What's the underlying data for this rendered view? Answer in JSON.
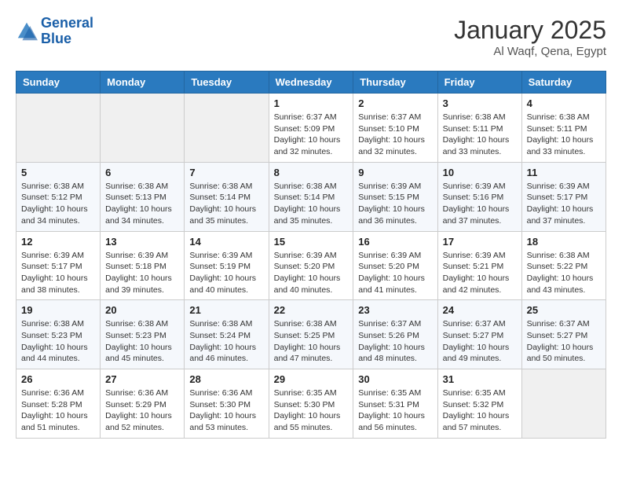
{
  "header": {
    "logo_line1": "General",
    "logo_line2": "Blue",
    "month": "January 2025",
    "location": "Al Waqf, Qena, Egypt"
  },
  "weekdays": [
    "Sunday",
    "Monday",
    "Tuesday",
    "Wednesday",
    "Thursday",
    "Friday",
    "Saturday"
  ],
  "weeks": [
    [
      {
        "day": "",
        "info": ""
      },
      {
        "day": "",
        "info": ""
      },
      {
        "day": "",
        "info": ""
      },
      {
        "day": "1",
        "info": "Sunrise: 6:37 AM\nSunset: 5:09 PM\nDaylight: 10 hours\nand 32 minutes."
      },
      {
        "day": "2",
        "info": "Sunrise: 6:37 AM\nSunset: 5:10 PM\nDaylight: 10 hours\nand 32 minutes."
      },
      {
        "day": "3",
        "info": "Sunrise: 6:38 AM\nSunset: 5:11 PM\nDaylight: 10 hours\nand 33 minutes."
      },
      {
        "day": "4",
        "info": "Sunrise: 6:38 AM\nSunset: 5:11 PM\nDaylight: 10 hours\nand 33 minutes."
      }
    ],
    [
      {
        "day": "5",
        "info": "Sunrise: 6:38 AM\nSunset: 5:12 PM\nDaylight: 10 hours\nand 34 minutes."
      },
      {
        "day": "6",
        "info": "Sunrise: 6:38 AM\nSunset: 5:13 PM\nDaylight: 10 hours\nand 34 minutes."
      },
      {
        "day": "7",
        "info": "Sunrise: 6:38 AM\nSunset: 5:14 PM\nDaylight: 10 hours\nand 35 minutes."
      },
      {
        "day": "8",
        "info": "Sunrise: 6:38 AM\nSunset: 5:14 PM\nDaylight: 10 hours\nand 35 minutes."
      },
      {
        "day": "9",
        "info": "Sunrise: 6:39 AM\nSunset: 5:15 PM\nDaylight: 10 hours\nand 36 minutes."
      },
      {
        "day": "10",
        "info": "Sunrise: 6:39 AM\nSunset: 5:16 PM\nDaylight: 10 hours\nand 37 minutes."
      },
      {
        "day": "11",
        "info": "Sunrise: 6:39 AM\nSunset: 5:17 PM\nDaylight: 10 hours\nand 37 minutes."
      }
    ],
    [
      {
        "day": "12",
        "info": "Sunrise: 6:39 AM\nSunset: 5:17 PM\nDaylight: 10 hours\nand 38 minutes."
      },
      {
        "day": "13",
        "info": "Sunrise: 6:39 AM\nSunset: 5:18 PM\nDaylight: 10 hours\nand 39 minutes."
      },
      {
        "day": "14",
        "info": "Sunrise: 6:39 AM\nSunset: 5:19 PM\nDaylight: 10 hours\nand 40 minutes."
      },
      {
        "day": "15",
        "info": "Sunrise: 6:39 AM\nSunset: 5:20 PM\nDaylight: 10 hours\nand 40 minutes."
      },
      {
        "day": "16",
        "info": "Sunrise: 6:39 AM\nSunset: 5:20 PM\nDaylight: 10 hours\nand 41 minutes."
      },
      {
        "day": "17",
        "info": "Sunrise: 6:39 AM\nSunset: 5:21 PM\nDaylight: 10 hours\nand 42 minutes."
      },
      {
        "day": "18",
        "info": "Sunrise: 6:38 AM\nSunset: 5:22 PM\nDaylight: 10 hours\nand 43 minutes."
      }
    ],
    [
      {
        "day": "19",
        "info": "Sunrise: 6:38 AM\nSunset: 5:23 PM\nDaylight: 10 hours\nand 44 minutes."
      },
      {
        "day": "20",
        "info": "Sunrise: 6:38 AM\nSunset: 5:23 PM\nDaylight: 10 hours\nand 45 minutes."
      },
      {
        "day": "21",
        "info": "Sunrise: 6:38 AM\nSunset: 5:24 PM\nDaylight: 10 hours\nand 46 minutes."
      },
      {
        "day": "22",
        "info": "Sunrise: 6:38 AM\nSunset: 5:25 PM\nDaylight: 10 hours\nand 47 minutes."
      },
      {
        "day": "23",
        "info": "Sunrise: 6:37 AM\nSunset: 5:26 PM\nDaylight: 10 hours\nand 48 minutes."
      },
      {
        "day": "24",
        "info": "Sunrise: 6:37 AM\nSunset: 5:27 PM\nDaylight: 10 hours\nand 49 minutes."
      },
      {
        "day": "25",
        "info": "Sunrise: 6:37 AM\nSunset: 5:27 PM\nDaylight: 10 hours\nand 50 minutes."
      }
    ],
    [
      {
        "day": "26",
        "info": "Sunrise: 6:36 AM\nSunset: 5:28 PM\nDaylight: 10 hours\nand 51 minutes."
      },
      {
        "day": "27",
        "info": "Sunrise: 6:36 AM\nSunset: 5:29 PM\nDaylight: 10 hours\nand 52 minutes."
      },
      {
        "day": "28",
        "info": "Sunrise: 6:36 AM\nSunset: 5:30 PM\nDaylight: 10 hours\nand 53 minutes."
      },
      {
        "day": "29",
        "info": "Sunrise: 6:35 AM\nSunset: 5:30 PM\nDaylight: 10 hours\nand 55 minutes."
      },
      {
        "day": "30",
        "info": "Sunrise: 6:35 AM\nSunset: 5:31 PM\nDaylight: 10 hours\nand 56 minutes."
      },
      {
        "day": "31",
        "info": "Sunrise: 6:35 AM\nSunset: 5:32 PM\nDaylight: 10 hours\nand 57 minutes."
      },
      {
        "day": "",
        "info": ""
      }
    ]
  ]
}
